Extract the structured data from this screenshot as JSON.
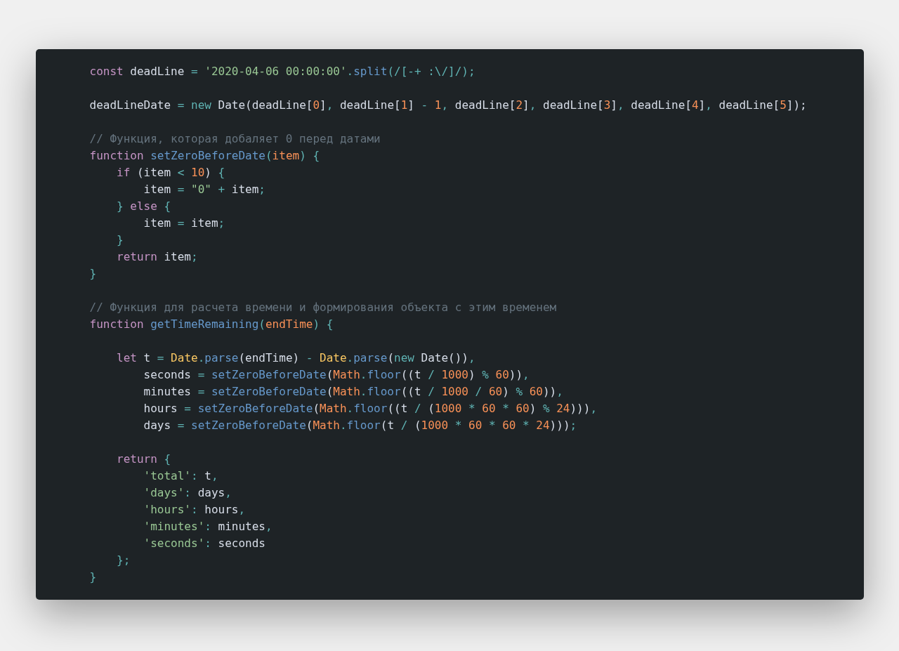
{
  "code_window": {
    "blocks": [
      {
        "lines": [
          {
            "tokens": [
              {
                "kind": "kw",
                "text": "const"
              },
              {
                "kind": "tx",
                "text": " deadLine "
              },
              {
                "kind": "op",
                "text": "= "
              },
              {
                "kind": "str",
                "text": "'2020-04-06 00:00:00'"
              },
              {
                "kind": "op",
                "text": "."
              },
              {
                "kind": "fn",
                "text": "split"
              },
              {
                "kind": "op",
                "text": "(/[-+ :\\/]/);"
              }
            ]
          }
        ]
      },
      {
        "lines": [
          {
            "tokens": [
              {
                "kind": "tx",
                "text": "deadLineDate "
              },
              {
                "kind": "op",
                "text": "= "
              },
              {
                "kind": "op",
                "text": "new"
              },
              {
                "kind": "tx",
                "text": " Date(deadLine["
              },
              {
                "kind": "num",
                "text": "0"
              },
              {
                "kind": "tx",
                "text": "]"
              },
              {
                "kind": "op",
                "text": ","
              },
              {
                "kind": "tx",
                "text": " deadLine["
              },
              {
                "kind": "num",
                "text": "1"
              },
              {
                "kind": "tx",
                "text": "] "
              },
              {
                "kind": "op",
                "text": "- "
              },
              {
                "kind": "num",
                "text": "1"
              },
              {
                "kind": "op",
                "text": ","
              },
              {
                "kind": "tx",
                "text": " deadLine["
              },
              {
                "kind": "num",
                "text": "2"
              },
              {
                "kind": "tx",
                "text": "]"
              },
              {
                "kind": "op",
                "text": ","
              },
              {
                "kind": "tx",
                "text": " deadLine["
              },
              {
                "kind": "num",
                "text": "3"
              },
              {
                "kind": "tx",
                "text": "]"
              },
              {
                "kind": "op",
                "text": ","
              },
              {
                "kind": "tx",
                "text": " deadLine["
              },
              {
                "kind": "num",
                "text": "4"
              },
              {
                "kind": "tx",
                "text": "]"
              },
              {
                "kind": "op",
                "text": ","
              },
              {
                "kind": "tx",
                "text": " deadLine["
              },
              {
                "kind": "num",
                "text": "5"
              },
              {
                "kind": "tx",
                "text": "]);"
              }
            ]
          }
        ]
      },
      {
        "lines": [
          {
            "tokens": [
              {
                "kind": "cm",
                "text": "// Функция, которая добаляет 0 перед датами"
              }
            ]
          },
          {
            "tokens": [
              {
                "kind": "kw",
                "text": "function "
              },
              {
                "kind": "fn",
                "text": "setZeroBeforeDate"
              },
              {
                "kind": "op",
                "text": "("
              },
              {
                "kind": "par",
                "text": "item"
              },
              {
                "kind": "op",
                "text": ") "
              },
              {
                "kind": "op",
                "text": "{"
              }
            ]
          },
          {
            "tokens": [
              {
                "kind": "kw",
                "text": "    if"
              },
              {
                "kind": "tx",
                "text": " (item "
              },
              {
                "kind": "op",
                "text": "< "
              },
              {
                "kind": "num",
                "text": "10"
              },
              {
                "kind": "tx",
                "text": ") "
              },
              {
                "kind": "op",
                "text": "{"
              }
            ]
          },
          {
            "tokens": [
              {
                "kind": "tx",
                "text": "        item "
              },
              {
                "kind": "op",
                "text": "= "
              },
              {
                "kind": "str",
                "text": "\"0\" "
              },
              {
                "kind": "op",
                "text": "+"
              },
              {
                "kind": "tx",
                "text": " item"
              },
              {
                "kind": "op",
                "text": ";"
              }
            ]
          },
          {
            "tokens": [
              {
                "kind": "op",
                "text": "    } "
              },
              {
                "kind": "kw",
                "text": "else "
              },
              {
                "kind": "op",
                "text": "{"
              }
            ]
          },
          {
            "tokens": [
              {
                "kind": "tx",
                "text": "        item "
              },
              {
                "kind": "op",
                "text": "="
              },
              {
                "kind": "tx",
                "text": " item"
              },
              {
                "kind": "op",
                "text": ";"
              }
            ]
          },
          {
            "tokens": [
              {
                "kind": "op",
                "text": "    }"
              }
            ]
          },
          {
            "tokens": [
              {
                "kind": "kw",
                "text": "    return"
              },
              {
                "kind": "tx",
                "text": " item"
              },
              {
                "kind": "op",
                "text": ";"
              }
            ]
          },
          {
            "tokens": [
              {
                "kind": "op",
                "text": "}"
              }
            ]
          }
        ]
      },
      {
        "lines": [
          {
            "tokens": [
              {
                "kind": "cm",
                "text": "// Функция для расчета времени и формирования объекта с этим временем"
              }
            ]
          },
          {
            "tokens": [
              {
                "kind": "kw",
                "text": "function "
              },
              {
                "kind": "fn",
                "text": "getTimeRemaining"
              },
              {
                "kind": "op",
                "text": "("
              },
              {
                "kind": "par",
                "text": "endTime"
              },
              {
                "kind": "op",
                "text": ") "
              },
              {
                "kind": "op",
                "text": "{"
              }
            ]
          }
        ]
      },
      {
        "lines": [
          {
            "tokens": [
              {
                "kind": "kw",
                "text": "    let"
              },
              {
                "kind": "tx",
                "text": " t "
              },
              {
                "kind": "op",
                "text": "= "
              },
              {
                "kind": "cls",
                "text": "Date"
              },
              {
                "kind": "op",
                "text": "."
              },
              {
                "kind": "fn",
                "text": "parse"
              },
              {
                "kind": "tx",
                "text": "(endTime) "
              },
              {
                "kind": "op",
                "text": "- "
              },
              {
                "kind": "cls",
                "text": "Date"
              },
              {
                "kind": "op",
                "text": "."
              },
              {
                "kind": "fn",
                "text": "parse"
              },
              {
                "kind": "tx",
                "text": "("
              },
              {
                "kind": "op",
                "text": "new"
              },
              {
                "kind": "tx",
                "text": " Date())"
              },
              {
                "kind": "op",
                "text": ","
              }
            ]
          },
          {
            "tokens": [
              {
                "kind": "tx",
                "text": "        seconds "
              },
              {
                "kind": "op",
                "text": "= "
              },
              {
                "kind": "fn",
                "text": "setZeroBeforeDate"
              },
              {
                "kind": "tx",
                "text": "("
              },
              {
                "kind": "par",
                "text": "Math"
              },
              {
                "kind": "op",
                "text": "."
              },
              {
                "kind": "fn",
                "text": "floor"
              },
              {
                "kind": "tx",
                "text": "((t "
              },
              {
                "kind": "op",
                "text": "/ "
              },
              {
                "kind": "num",
                "text": "1000"
              },
              {
                "kind": "tx",
                "text": ") "
              },
              {
                "kind": "op",
                "text": "% "
              },
              {
                "kind": "num",
                "text": "60"
              },
              {
                "kind": "tx",
                "text": "))"
              },
              {
                "kind": "op",
                "text": ","
              }
            ]
          },
          {
            "tokens": [
              {
                "kind": "tx",
                "text": "        minutes "
              },
              {
                "kind": "op",
                "text": "= "
              },
              {
                "kind": "fn",
                "text": "setZeroBeforeDate"
              },
              {
                "kind": "tx",
                "text": "("
              },
              {
                "kind": "par",
                "text": "Math"
              },
              {
                "kind": "op",
                "text": "."
              },
              {
                "kind": "fn",
                "text": "floor"
              },
              {
                "kind": "tx",
                "text": "((t "
              },
              {
                "kind": "op",
                "text": "/ "
              },
              {
                "kind": "num",
                "text": "1000 "
              },
              {
                "kind": "op",
                "text": "/ "
              },
              {
                "kind": "num",
                "text": "60"
              },
              {
                "kind": "tx",
                "text": ") "
              },
              {
                "kind": "op",
                "text": "% "
              },
              {
                "kind": "num",
                "text": "60"
              },
              {
                "kind": "tx",
                "text": "))"
              },
              {
                "kind": "op",
                "text": ","
              }
            ]
          },
          {
            "tokens": [
              {
                "kind": "tx",
                "text": "        hours "
              },
              {
                "kind": "op",
                "text": "= "
              },
              {
                "kind": "fn",
                "text": "setZeroBeforeDate"
              },
              {
                "kind": "tx",
                "text": "("
              },
              {
                "kind": "par",
                "text": "Math"
              },
              {
                "kind": "op",
                "text": "."
              },
              {
                "kind": "fn",
                "text": "floor"
              },
              {
                "kind": "tx",
                "text": "((t "
              },
              {
                "kind": "op",
                "text": "/"
              },
              {
                "kind": "tx",
                "text": " ("
              },
              {
                "kind": "num",
                "text": "1000 "
              },
              {
                "kind": "op",
                "text": "* "
              },
              {
                "kind": "num",
                "text": "60 "
              },
              {
                "kind": "op",
                "text": "* "
              },
              {
                "kind": "num",
                "text": "60"
              },
              {
                "kind": "tx",
                "text": ") "
              },
              {
                "kind": "op",
                "text": "% "
              },
              {
                "kind": "num",
                "text": "24"
              },
              {
                "kind": "tx",
                "text": ")))"
              },
              {
                "kind": "op",
                "text": ","
              }
            ]
          },
          {
            "tokens": [
              {
                "kind": "tx",
                "text": "        days "
              },
              {
                "kind": "op",
                "text": "= "
              },
              {
                "kind": "fn",
                "text": "setZeroBeforeDate"
              },
              {
                "kind": "tx",
                "text": "("
              },
              {
                "kind": "par",
                "text": "Math"
              },
              {
                "kind": "op",
                "text": "."
              },
              {
                "kind": "fn",
                "text": "floor"
              },
              {
                "kind": "tx",
                "text": "(t "
              },
              {
                "kind": "op",
                "text": "/"
              },
              {
                "kind": "tx",
                "text": " ("
              },
              {
                "kind": "num",
                "text": "1000 "
              },
              {
                "kind": "op",
                "text": "* "
              },
              {
                "kind": "num",
                "text": "60 "
              },
              {
                "kind": "op",
                "text": "* "
              },
              {
                "kind": "num",
                "text": "60 "
              },
              {
                "kind": "op",
                "text": "* "
              },
              {
                "kind": "num",
                "text": "24"
              },
              {
                "kind": "tx",
                "text": ")))"
              },
              {
                "kind": "op",
                "text": ";"
              }
            ]
          }
        ]
      },
      {
        "lines": [
          {
            "tokens": [
              {
                "kind": "kw",
                "text": "    return "
              },
              {
                "kind": "op",
                "text": "{"
              }
            ]
          },
          {
            "tokens": [
              {
                "kind": "str",
                "text": "        'total'"
              },
              {
                "kind": "op",
                "text": ":"
              },
              {
                "kind": "tx",
                "text": " t"
              },
              {
                "kind": "op",
                "text": ","
              }
            ]
          },
          {
            "tokens": [
              {
                "kind": "str",
                "text": "        'days'"
              },
              {
                "kind": "op",
                "text": ":"
              },
              {
                "kind": "tx",
                "text": " days"
              },
              {
                "kind": "op",
                "text": ","
              }
            ]
          },
          {
            "tokens": [
              {
                "kind": "str",
                "text": "        'hours'"
              },
              {
                "kind": "op",
                "text": ":"
              },
              {
                "kind": "tx",
                "text": " hours"
              },
              {
                "kind": "op",
                "text": ","
              }
            ]
          },
          {
            "tokens": [
              {
                "kind": "str",
                "text": "        'minutes'"
              },
              {
                "kind": "op",
                "text": ":"
              },
              {
                "kind": "tx",
                "text": " minutes"
              },
              {
                "kind": "op",
                "text": ","
              }
            ]
          },
          {
            "tokens": [
              {
                "kind": "str",
                "text": "        'seconds'"
              },
              {
                "kind": "op",
                "text": ":"
              },
              {
                "kind": "tx",
                "text": " seconds"
              }
            ]
          },
          {
            "tokens": [
              {
                "kind": "op",
                "text": "    };"
              }
            ]
          },
          {
            "tokens": [
              {
                "kind": "op",
                "text": "}"
              }
            ]
          }
        ]
      }
    ]
  }
}
